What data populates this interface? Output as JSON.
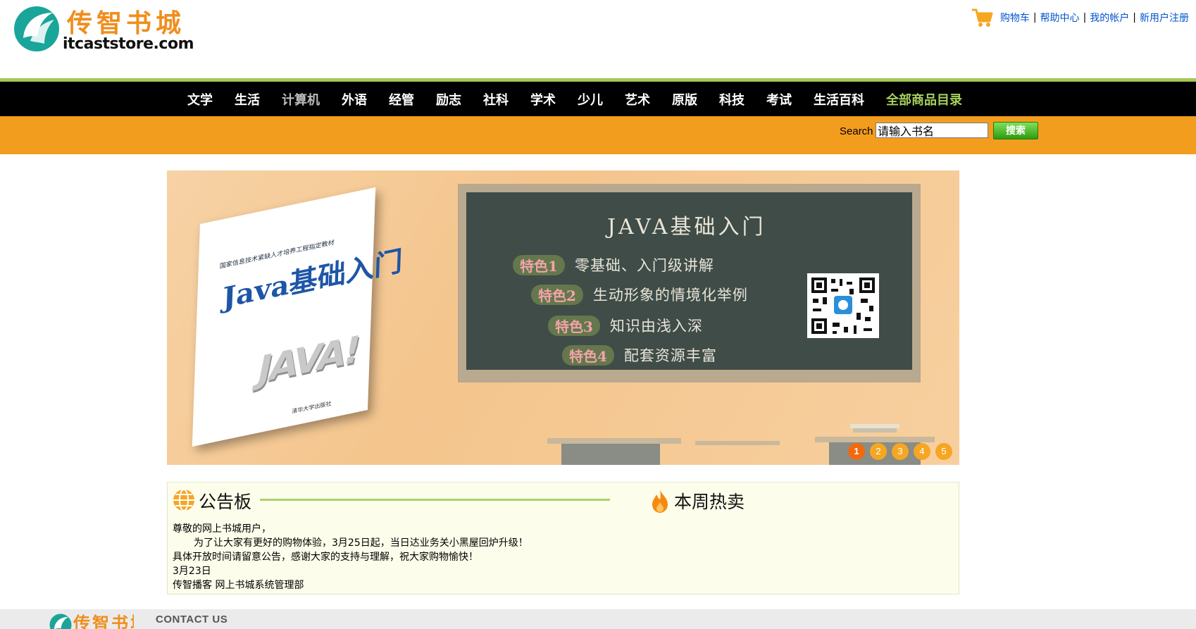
{
  "header": {
    "logo_cn": "传智书城",
    "logo_en": "itcaststore.com",
    "links": [
      "购物车",
      "帮助中心",
      "我的帐户",
      "新用户注册"
    ],
    "separator": "|"
  },
  "nav": {
    "items": [
      "文学",
      "生活",
      "计算机",
      "外语",
      "经管",
      "励志",
      "社科",
      "学术",
      "少儿",
      "艺术",
      "原版",
      "科技",
      "考试",
      "生活百科",
      "全部商品目录"
    ],
    "active": "计算机"
  },
  "search": {
    "label": "Search",
    "placeholder": "请输入书名",
    "button": "搜索"
  },
  "banner": {
    "board_title": "JAVA基础入门",
    "features": [
      {
        "tag": "特色1",
        "text": "零基础、入门级讲解"
      },
      {
        "tag": "特色2",
        "text": "生动形象的情境化举例"
      },
      {
        "tag": "特色3",
        "text": "知识由浅入深"
      },
      {
        "tag": "特色4",
        "text": "配套资源丰富"
      }
    ],
    "book_title": "Java基础入门",
    "book_series": "国家信息技术紧缺人才培养工程指定教材",
    "book_java": "JAVA!",
    "book_publisher": "清华大学出版社",
    "pages": [
      "1",
      "2",
      "3",
      "4",
      "5"
    ],
    "active_page": "1"
  },
  "notice": {
    "title": "公告板",
    "hot_title": "本周热卖",
    "lines": [
      "尊敬的网上书城用户，",
      "为了让大家有更好的购物体验，3月25日起，当日达业务关小黑屋回炉升级！",
      "具体开放时间请留意公告，感谢大家的支持与理解，祝大家购物愉快！",
      "3月23日",
      "传智播客 网上书城系统管理部"
    ]
  },
  "footer": {
    "logo_cn": "传智书城",
    "contact": "CONTACT US"
  },
  "colors": {
    "brand_orange": "#f39d1f",
    "nav_green": "#a3c85a",
    "link_blue": "#0055cc"
  }
}
